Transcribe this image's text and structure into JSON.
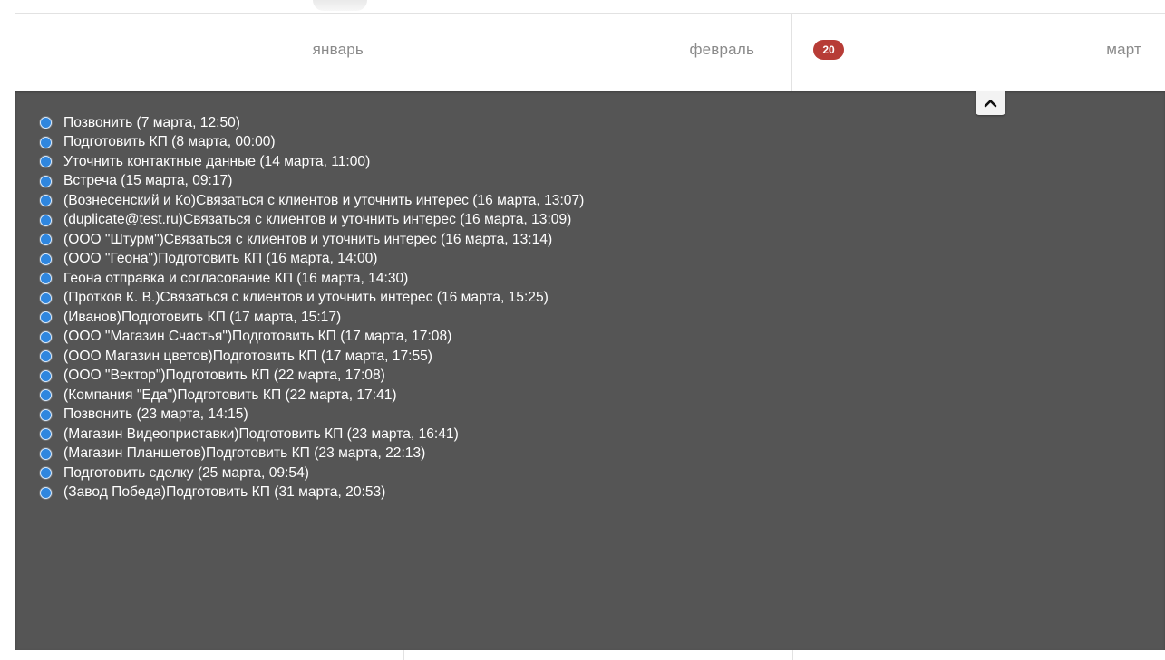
{
  "calendar": {
    "months": [
      {
        "name": "январь"
      },
      {
        "name": "февраль"
      },
      {
        "name": "март",
        "badge": "20"
      }
    ]
  },
  "events_panel": {
    "collapse_icon": "chevron-up-icon",
    "colors": {
      "panel_background": "#555555",
      "event_dot": "#2f86de",
      "badge": "#b73c36"
    },
    "items": [
      "Позвонить (7 марта, 12:50)",
      "Подготовить КП (8 марта, 00:00)",
      "Уточнить контактные данные (14 марта, 11:00)",
      "Встреча (15 марта, 09:17)",
      "(Вознесенский и Ко)Связаться с клиентов и уточнить интерес (16 марта, 13:07)",
      "(duplicate@test.ru)Связаться с клиентов и уточнить интерес (16 марта, 13:09)",
      "(ООО \"Штурм\")Связаться с клиентов и уточнить интерес (16 марта, 13:14)",
      "(ООО \"Геона\")Подготовить КП (16 марта, 14:00)",
      "Геона отправка и согласование КП (16 марта, 14:30)",
      "(Протков К. В.)Связаться с клиентов и уточнить интерес (16 марта, 15:25)",
      "(Иванов)Подготовить КП (17 марта, 15:17)",
      "(ООО \"Магазин Счастья\")Подготовить КП (17 марта, 17:08)",
      "(ООО Магазин цветов)Подготовить КП (17 марта, 17:55)",
      "(ООО \"Вектор\")Подготовить КП (22 марта, 17:08)",
      "(Компания \"Еда\")Подготовить КП (22 марта, 17:41)",
      "Позвонить (23 марта, 14:15)",
      "(Магазин Видеоприставки)Подготовить КП (23 марта, 16:41)",
      "(Магазин Планшетов)Подготовить КП (23 марта, 22:13)",
      "Подготовить сделку (25 марта, 09:54)",
      "(Завод Победа)Подготовить КП (31 марта, 20:53)"
    ]
  }
}
